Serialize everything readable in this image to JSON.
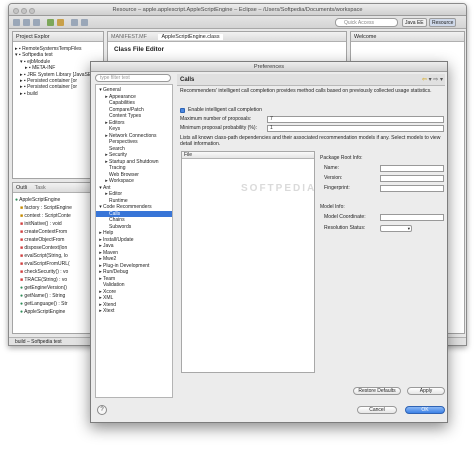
{
  "window": {
    "title": "Resource – apple.applescript.AppleScriptEngine – Eclipse – /Users/Softpedia/Documents/workspace",
    "quick_access_placeholder": "Quick Access",
    "perspectives": [
      "Java EE",
      "Resource"
    ]
  },
  "project_explorer": {
    "tab_label": "Project Explor",
    "items": [
      {
        "label": "RemoteSystemsTempFiles",
        "indent": 0
      },
      {
        "label": "Softpedia test",
        "indent": 0
      },
      {
        "label": "ejbModule",
        "indent": 1
      },
      {
        "label": "META-INF",
        "indent": 2
      },
      {
        "label": "JRE System Library [JavaSE",
        "indent": 1
      },
      {
        "label": "Persisted container [or",
        "indent": 1
      },
      {
        "label": "Persisted container [or",
        "indent": 1
      },
      {
        "label": "build",
        "indent": 1
      }
    ]
  },
  "editor": {
    "tabs": [
      "MANIFEST.MF",
      "AppleScriptEngine.class"
    ],
    "header": "Class File Editor"
  },
  "welcome": {
    "tab_label": "Welcome"
  },
  "outline": {
    "tabs": [
      "Outli",
      "Task"
    ],
    "items": [
      "AppleScriptEngine",
      "factory : ScriptEngine",
      "context : ScriptConte",
      "initNative() : void",
      "createContextFrom",
      "createObjectFrom",
      "disposeContext(lon",
      "evalScript(String, lo",
      "evalScriptFromURL(",
      "checkSecurity() : vo",
      "TRACE(String) : vo",
      "getEngineVersion()",
      "getName() : String",
      "getLanguage() : Str",
      "AppleScriptEngine"
    ]
  },
  "statusbar": {
    "text": "build – Softpedia test"
  },
  "dialog": {
    "title": "Preferences",
    "filter_placeholder": "type filter text",
    "nav": [
      {
        "label": "General",
        "indent": 0,
        "arrow": "▾"
      },
      {
        "label": "Appearance",
        "indent": 1,
        "arrow": "▸"
      },
      {
        "label": "Capabilities",
        "indent": 1,
        "arrow": ""
      },
      {
        "label": "Compare/Patch",
        "indent": 1,
        "arrow": ""
      },
      {
        "label": "Content Types",
        "indent": 1,
        "arrow": ""
      },
      {
        "label": "Editors",
        "indent": 1,
        "arrow": "▸"
      },
      {
        "label": "Keys",
        "indent": 1,
        "arrow": ""
      },
      {
        "label": "Network Connections",
        "indent": 1,
        "arrow": "▸"
      },
      {
        "label": "Perspectives",
        "indent": 1,
        "arrow": ""
      },
      {
        "label": "Search",
        "indent": 1,
        "arrow": ""
      },
      {
        "label": "Security",
        "indent": 1,
        "arrow": "▸"
      },
      {
        "label": "Startup and Shutdown",
        "indent": 1,
        "arrow": "▸"
      },
      {
        "label": "Tracing",
        "indent": 1,
        "arrow": ""
      },
      {
        "label": "Web Browser",
        "indent": 1,
        "arrow": ""
      },
      {
        "label": "Workspace",
        "indent": 1,
        "arrow": "▸"
      },
      {
        "label": "Ant",
        "indent": 0,
        "arrow": "▾"
      },
      {
        "label": "Editor",
        "indent": 1,
        "arrow": "▸"
      },
      {
        "label": "Runtime",
        "indent": 1,
        "arrow": ""
      },
      {
        "label": "Code Recommenders",
        "indent": 0,
        "arrow": "▾"
      },
      {
        "label": "Calls",
        "indent": 1,
        "arrow": "",
        "selected": true
      },
      {
        "label": "Chains",
        "indent": 1,
        "arrow": ""
      },
      {
        "label": "Subwords",
        "indent": 1,
        "arrow": ""
      },
      {
        "label": "Help",
        "indent": 0,
        "arrow": "▸"
      },
      {
        "label": "Install/Update",
        "indent": 0,
        "arrow": "▸"
      },
      {
        "label": "Java",
        "indent": 0,
        "arrow": "▸"
      },
      {
        "label": "Maven",
        "indent": 0,
        "arrow": "▸"
      },
      {
        "label": "Mwe2",
        "indent": 0,
        "arrow": "▸"
      },
      {
        "label": "Plug-in Development",
        "indent": 0,
        "arrow": "▸"
      },
      {
        "label": "Run/Debug",
        "indent": 0,
        "arrow": "▸"
      },
      {
        "label": "Team",
        "indent": 0,
        "arrow": "▸"
      },
      {
        "label": "Validation",
        "indent": 0,
        "arrow": ""
      },
      {
        "label": "Xcore",
        "indent": 0,
        "arrow": "▸"
      },
      {
        "label": "XML",
        "indent": 0,
        "arrow": "▸"
      },
      {
        "label": "Xtend",
        "indent": 0,
        "arrow": "▸"
      },
      {
        "label": "Xtext",
        "indent": 0,
        "arrow": "▸"
      }
    ],
    "page_title": "Calls",
    "description": "Recommenders' intelligent call completion provides method calls based on previously collected usage statistics.",
    "enable_label": "Enable intelligent call completion",
    "enable_checked": true,
    "max_proposals_label": "Maximum number of proposals:",
    "max_proposals_value": "7",
    "min_prob_label": "Minimum proposal probability (%):",
    "min_prob_value": "1",
    "list_description": "Lists all known class-path dependencies and their associated recommendation models if any. Select models to view detail information.",
    "table_header": "File",
    "package_root_title": "Package Root Info:",
    "package_fields": [
      "Name:",
      "Version:",
      "Fingerprint:"
    ],
    "model_info_title": "Model Info:",
    "model_fields": [
      "Model Coordinate:",
      "Resolution Status:"
    ],
    "restore_label": "Restore Defaults",
    "apply_label": "Apply",
    "cancel_label": "Cancel",
    "ok_label": "OK",
    "watermark": "SOFTPEDIA"
  }
}
